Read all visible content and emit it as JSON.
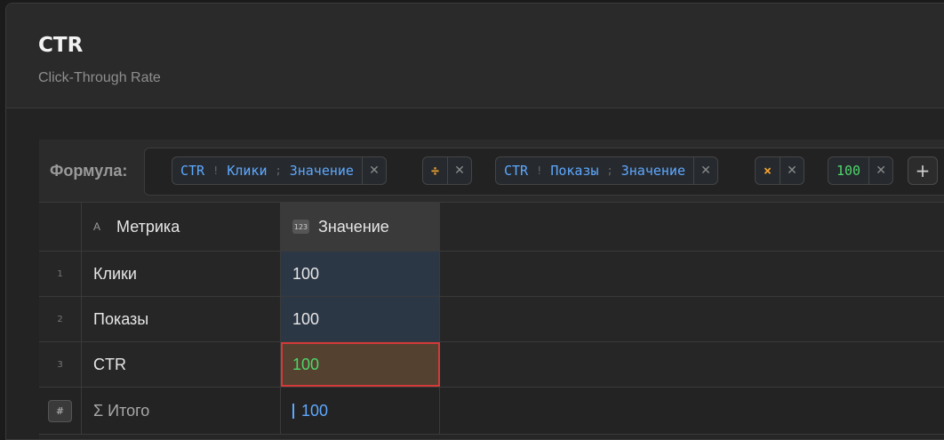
{
  "header": {
    "title": "CTR",
    "subtitle": "Click-Through Rate"
  },
  "formula": {
    "label": "Формула:",
    "tokens": [
      {
        "kind": "ref",
        "parts": [
          "CTR",
          "Клики",
          "Значение"
        ],
        "seps": [
          "!",
          ";"
        ]
      },
      {
        "kind": "op",
        "symbol": "÷"
      },
      {
        "kind": "ref",
        "parts": [
          "CTR",
          "Показы",
          "Значение"
        ],
        "seps": [
          "!",
          ";"
        ]
      },
      {
        "kind": "op",
        "symbol": "×"
      },
      {
        "kind": "num",
        "value": "100"
      }
    ],
    "remove_glyph": "✕",
    "add_glyph": "+"
  },
  "table": {
    "columns": [
      {
        "type_icon": "A",
        "label": "Метрика"
      },
      {
        "type_icon": "123",
        "label": "Значение"
      }
    ],
    "rows": [
      {
        "index": "1",
        "name": "Клики",
        "value": "100"
      },
      {
        "index": "2",
        "name": "Показы",
        "value": "100"
      },
      {
        "index": "3",
        "name": "CTR",
        "value": "100"
      }
    ],
    "total": {
      "badge": "#",
      "label": "Σ Итого",
      "value": "100"
    }
  },
  "colors": {
    "accent": "#5ea8ff",
    "operator": "#f0a030",
    "number": "#4fd66a",
    "selection_border": "#d33a3a"
  }
}
